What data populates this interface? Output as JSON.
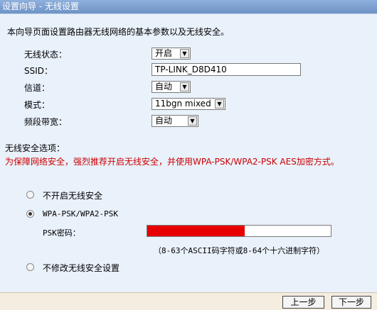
{
  "window": {
    "title": "设置向导 - 无线设置"
  },
  "intro": "本向导页面设置路由器无线网络的基本参数以及无线安全。",
  "fields": {
    "wireless_status": {
      "label": "无线状态：",
      "value": "开启"
    },
    "ssid": {
      "label": "SSID：",
      "value": "TP-LINK_D8D410"
    },
    "channel": {
      "label": "信道：",
      "value": "自动"
    },
    "mode": {
      "label": "模式：",
      "value": "11bgn mixed"
    },
    "bandwidth": {
      "label": "频段带宽：",
      "value": "自动"
    }
  },
  "security": {
    "title": "无线安全选项：",
    "warning": "为保障网络安全，强烈推荐开启无线安全，并使用WPA-PSK/WPA2-PSK AES加密方式。",
    "options": [
      {
        "label": "不开启无线安全",
        "checked": false
      },
      {
        "label": "WPA-PSK/WPA2-PSK",
        "checked": true
      },
      {
        "label": "不修改无线安全设置",
        "checked": false
      }
    ],
    "psk_label": "PSK密码：",
    "psk_hint": "（8-63个ASCII码字符或8-64个十六进制字符）"
  },
  "buttons": {
    "prev": "上一步",
    "next": "下一步"
  },
  "colors": {
    "titlebar": "#7a9dd0",
    "panel": "#e9f1fb",
    "warning": "#cc0000",
    "redaction": "#e60000"
  }
}
